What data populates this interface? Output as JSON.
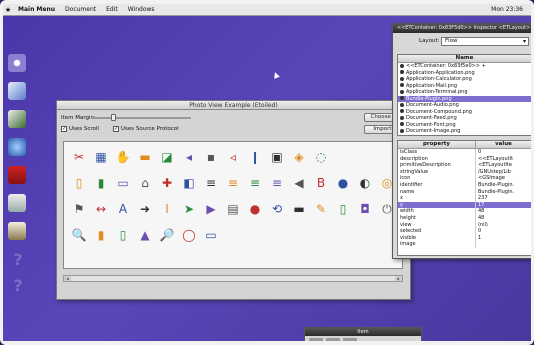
{
  "menubar": {
    "logo": "★",
    "items": [
      "Main Menu",
      "Document",
      "Edit",
      "Windows"
    ],
    "clock": "Mon 23:36"
  },
  "photo_window": {
    "title": "Photo View Example (Etoiled)",
    "item_margin_label": "Item Margin:",
    "uses_scroll_label": "Uses Scroll",
    "uses_source_protocol_label": "Uses Source Protocol",
    "choose_button": "Choose an",
    "import_button": "Import P",
    "scroll_left": "◂",
    "scroll_right": "▸"
  },
  "inspector": {
    "title": "<<ETContainer: 0x83F5d0>> Inspector <ETLayout>",
    "layout_label": "Layout:",
    "layout_value": "Flow",
    "name_header": "Name",
    "name_rows": [
      "<<ETContainer: 0x83f5e0>> +",
      "Application-Application.png",
      "Application-Calculator.png",
      "Application-Mail.png",
      "Application-Terminal.png",
      "Bundle-Plugin.png",
      "Document-Audio.png",
      "Document-Compound.png",
      "Document-Feed.png",
      "Document-Font.png",
      "Document-Image.png"
    ],
    "selected_name_index": 5,
    "prop_headers": [
      "property",
      "value"
    ],
    "props": [
      [
        "isClass",
        "0"
      ],
      [
        "description",
        "<<ETLayoutIt"
      ],
      [
        "primitiveDescription",
        "<ETLayoutIte"
      ],
      [
        "stringValue",
        "/GNUstep/Lib"
      ],
      [
        "icon",
        "<GSImage"
      ],
      [
        "identifier",
        "Bundle-Plugin."
      ],
      [
        "name",
        "Bundle-Plugin."
      ],
      [
        "x",
        "237"
      ],
      [
        "y",
        "17"
      ],
      [
        "width",
        "48"
      ],
      [
        "height",
        "48"
      ],
      [
        "view",
        "(nil)"
      ],
      [
        "selected",
        "0"
      ],
      [
        "visible",
        "1"
      ],
      [
        "image",
        ""
      ]
    ],
    "selected_prop_index": 8
  },
  "small_window": {
    "title": "Item"
  },
  "dock": {
    "icons": [
      "star-icon",
      "bird-icon",
      "checklist-icon",
      "globe-icon",
      "book-icon",
      "calculator-icon",
      "drawer-icon",
      "unknown-icon",
      "unknown-icon"
    ]
  },
  "icon_view": {
    "rows": [
      [
        "✂",
        "▦",
        "✋",
        "▬",
        "◪",
        "◂",
        "▪",
        "◃",
        "❙",
        "▣",
        "◈",
        "◌",
        "",
        "",
        ""
      ],
      [
        "▯",
        "▮",
        "▭",
        "⌂",
        "✚",
        "◧",
        "≡",
        "≡",
        "≡",
        "≡",
        "◀",
        "B",
        "●",
        "◐",
        "◎"
      ],
      [
        "⚑",
        "↔",
        "A",
        "➜",
        "I",
        "➤",
        "▶",
        "▤",
        "●",
        "⟲",
        "▬",
        "✎",
        "▯",
        "◘",
        "⏻"
      ],
      [
        "🔍",
        "▮",
        "▯",
        "▲",
        "🔎",
        "◯",
        "▭",
        "",
        "",
        "",
        "",
        "",
        "",
        "",
        ""
      ]
    ],
    "colors": {
      "accent": "#7d6fd0",
      "desktop": "#4a36a8"
    }
  }
}
